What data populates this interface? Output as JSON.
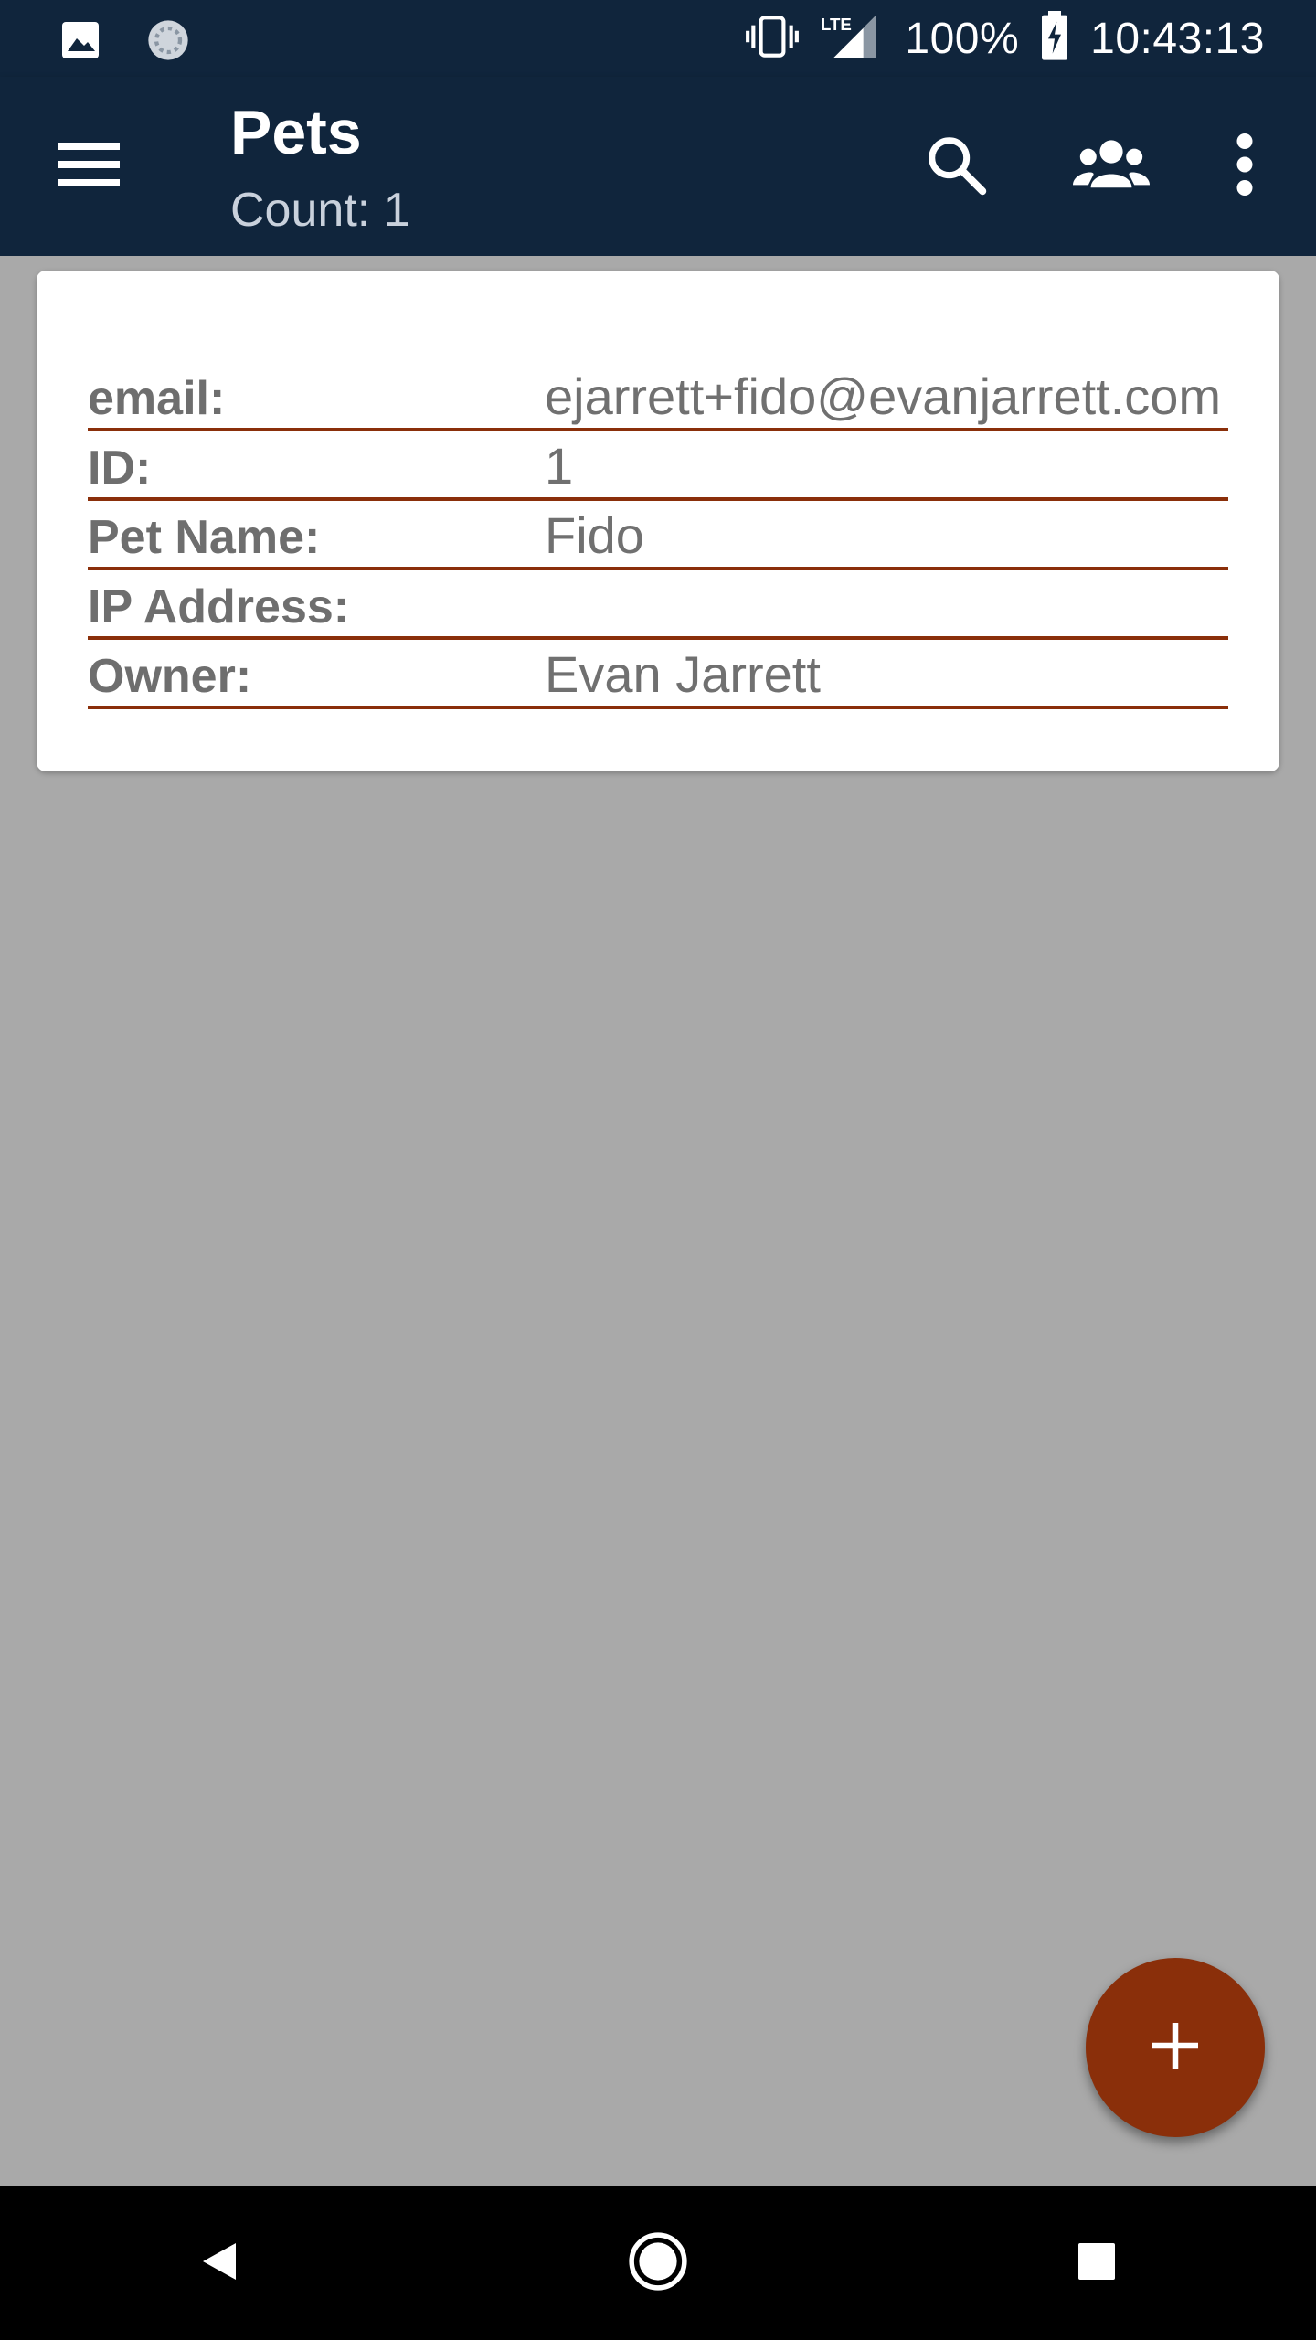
{
  "status_bar": {
    "battery": "100%",
    "time": "10:43:13",
    "network": "LTE",
    "icons": [
      "image-icon",
      "sync-icon",
      "vibrate-icon",
      "signal-icon",
      "battery-charging-icon"
    ]
  },
  "app_bar": {
    "title": "Pets",
    "subtitle": "Count: 1",
    "icons": [
      "menu-icon",
      "search-icon",
      "people-icon",
      "more-vert-icon"
    ]
  },
  "record": {
    "rows": [
      {
        "label": "email:",
        "value": "ejarrett+fido@evanjarrett.com"
      },
      {
        "label": "ID:",
        "value": "1"
      },
      {
        "label": "Pet Name:",
        "value": "Fido"
      },
      {
        "label": "IP Address:",
        "value": ""
      },
      {
        "label": "Owner:",
        "value": "Evan Jarrett"
      }
    ]
  },
  "fab": {
    "icon": "add-icon"
  },
  "nav_bar": {
    "icons": [
      "back-icon",
      "home-icon",
      "recents-icon"
    ]
  },
  "colors": {
    "primary_dark": "#10253c",
    "accent": "#8a2f0a",
    "background": "#a9a9a9"
  }
}
